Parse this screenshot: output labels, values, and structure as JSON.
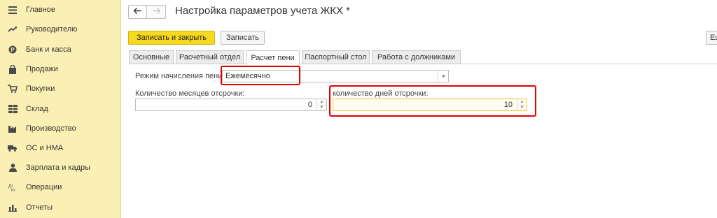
{
  "sidebar": {
    "items": [
      {
        "label": "Главное",
        "icon": "menu-icon"
      },
      {
        "label": "Руководителю",
        "icon": "trend-icon"
      },
      {
        "label": "Банк и касса",
        "icon": "bank-icon"
      },
      {
        "label": "Продажи",
        "icon": "bag-icon"
      },
      {
        "label": "Покупки",
        "icon": "cart-icon"
      },
      {
        "label": "Склад",
        "icon": "warehouse-icon"
      },
      {
        "label": "Производство",
        "icon": "factory-icon"
      },
      {
        "label": "ОС и НМА",
        "icon": "truck-icon"
      },
      {
        "label": "Зарплата и кадры",
        "icon": "person-icon"
      },
      {
        "label": "Операции",
        "icon": "operations-icon"
      },
      {
        "label": "Отчеты",
        "icon": "reports-icon"
      }
    ]
  },
  "header": {
    "title": "Настройка параметров учета ЖКХ *"
  },
  "toolbar": {
    "save_close_label": "Записать и закрыть",
    "save_label": "Записать",
    "more_label": "Ещё"
  },
  "tabs": [
    {
      "label": "Основные",
      "active": false
    },
    {
      "label": "Расчетный отдел",
      "active": false
    },
    {
      "label": "Расчет пени",
      "active": true
    },
    {
      "label": "Паспортный стол",
      "active": false
    },
    {
      "label": "Работа с должниками",
      "active": false
    }
  ],
  "form": {
    "penalty_mode": {
      "label": "Режим начисления пени:",
      "value": "Ежемесячно"
    },
    "deferral_months": {
      "label": "Количество месяцев отсрочки:",
      "value": "0"
    },
    "deferral_days": {
      "label": "количество дней отсрочки:",
      "value": "10"
    }
  },
  "colors": {
    "sidebar_bg": "#fbf0b4",
    "primary_button": "#f7d91f",
    "highlight": "#e00000"
  }
}
